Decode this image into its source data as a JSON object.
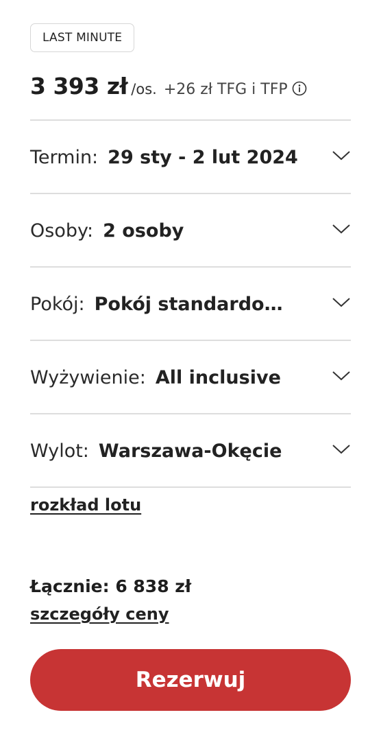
{
  "badge": "LAST MINUTE",
  "price": {
    "amount": "3 393 zł",
    "unit": "/os.",
    "extra": "+26 zł TFG i TFP"
  },
  "options": [
    {
      "label": "Termin:",
      "value": "29 sty - 2 lut 2024"
    },
    {
      "label": "Osoby:",
      "value": "2 osoby"
    },
    {
      "label": "Pokój:",
      "value": "Pokój standardowy (b..."
    },
    {
      "label": "Wyżywienie:",
      "value": "All inclusive"
    },
    {
      "label": "Wylot:",
      "value": "Warszawa-Okęcie"
    }
  ],
  "flight_schedule_link": "rozkład lotu",
  "total": "Łącznie: 6 838 zł",
  "price_details_link": "szczegóły ceny",
  "book_button": "Rezerwuj",
  "colors": {
    "accent": "#c73434",
    "divider": "#dddddd"
  }
}
